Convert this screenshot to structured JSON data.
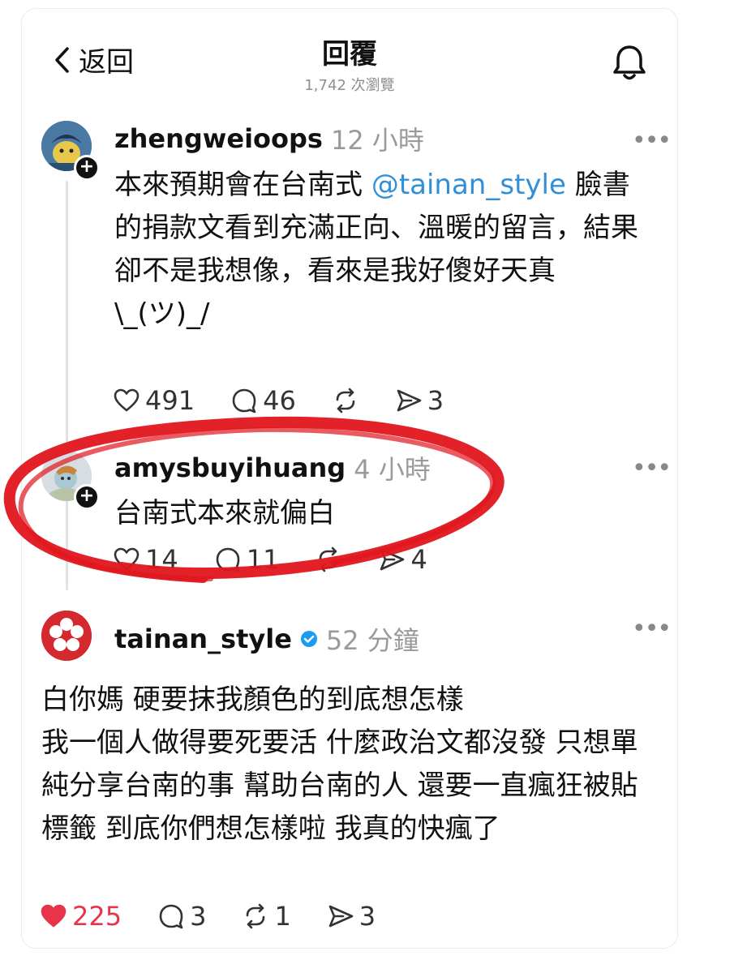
{
  "header": {
    "back_label": "返回",
    "title": "回覆",
    "views": "1,742 次瀏覽"
  },
  "posts": [
    {
      "username": "zhengweioops",
      "time": "12 小時",
      "text_before": "本來預期會在台南式 ",
      "mention": "@tainan_style",
      "text_after": " 臉書的捐款文看到充滿正向、溫暖的留言，結果卻不是我想像，看來是我好傻好天真",
      "emoticon": "\\_(ツ)_/",
      "likes": "491",
      "comments": "46",
      "shares": "3"
    },
    {
      "username": "amysbuyihuang",
      "time": "4 小時",
      "text": "台南式本來就偏白",
      "likes": "14",
      "comments": "11",
      "shares": "4"
    },
    {
      "username": "tainan_style",
      "time": "52 分鐘",
      "line1": "白你媽 硬要抹我顏色的到底想怎樣",
      "line2": "我一個人做得要死要活 什麼政治文都沒發 只想單純分享台南的事 幫助台南的人 還要一直瘋狂被貼標籤 到底你們想怎樣啦 我真的快瘋了",
      "likes": "225",
      "comments": "3",
      "reposts": "1",
      "shares": "3"
    }
  ],
  "colors": {
    "mention": "#2f8fd8",
    "like_active": "#e8344a",
    "verified": "#1d9bf0",
    "annotation": "#e0161c"
  },
  "icons": [
    "back-chevron-icon",
    "bell-icon",
    "heart-icon",
    "comment-icon",
    "repost-icon",
    "send-icon",
    "more-icon",
    "verified-icon"
  ]
}
